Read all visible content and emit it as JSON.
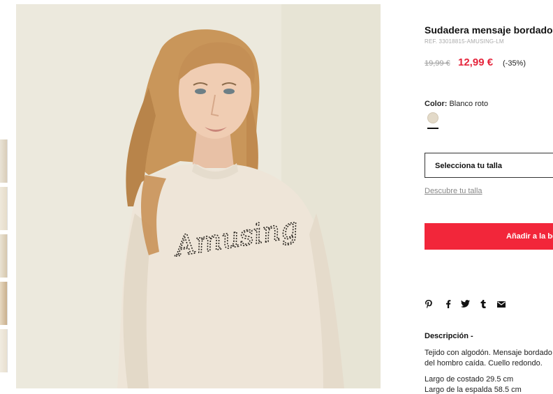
{
  "product": {
    "title": "Sudadera mensaje bordado",
    "ref": "REF. 33018815-AMUSING-LM",
    "price_old": "19,99 €",
    "price_new": "12,99 €",
    "discount": "(-35%)",
    "color_label": "Color:",
    "color_value": "Blanco roto",
    "swatch_color": "#e3dac9",
    "size_select_label": "Selecciona tu talla",
    "size_guide_link": "Descubre tu talla",
    "add_button_label": "Añadir a la bolsa",
    "accent_color": "#f2263a",
    "price_color": "#e5243b"
  },
  "image": {
    "print_text": "Amusing"
  },
  "share": {
    "icons": [
      "pinterest-icon",
      "facebook-icon",
      "twitter-icon",
      "tumblr-icon",
      "email-icon"
    ]
  },
  "description": {
    "title": "Descripción -",
    "line1": "Tejido con algodón. Mensaje bordado",
    "line2": "del hombro caída. Cuello redondo.",
    "measure1": "Largo de costado 29.5 cm",
    "measure2": "Largo de la espalda 58.5 cm"
  }
}
